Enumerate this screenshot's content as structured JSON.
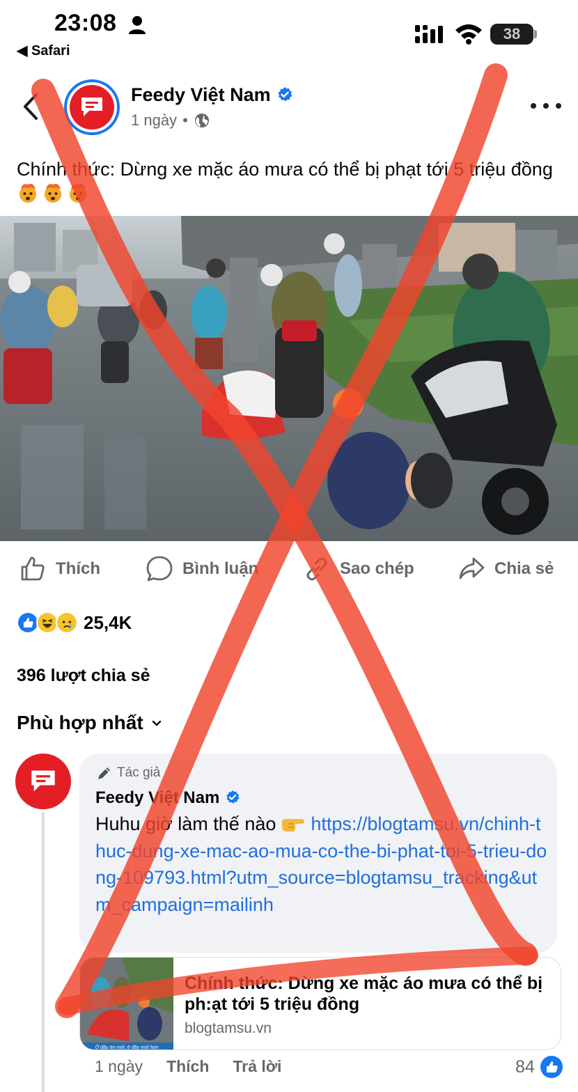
{
  "status_bar": {
    "time": "23:08",
    "back_app": "◀ Safari",
    "battery": "38"
  },
  "post": {
    "page_name": "Feedy Việt Nam",
    "time_ago": "1 ngày",
    "separator": "•",
    "text": "Chính thức: Dừng xe mặc áo mưa có thể bị phạt tới 5 triệu đồng",
    "emojis": [
      "exploding-head-icon",
      "exploding-head-icon",
      "exploding-head-icon"
    ]
  },
  "actions": {
    "like": "Thích",
    "comment": "Bình luận",
    "copy": "Sao chép",
    "share": "Chia sẻ"
  },
  "engagement": {
    "reaction_count": "25,4K",
    "reaction_icons": [
      "like-reaction-icon",
      "haha-reaction-icon",
      "sad-reaction-icon"
    ],
    "shares": "396 lượt chia sẻ",
    "sort": "Phù hợp nhất"
  },
  "comment": {
    "author_tag": "Tác giả",
    "author": "Feedy Việt Nam",
    "text_prefix": "Huhu giờ làm thế nào",
    "link": "https://blogtamsu.vn/chinh-thuc-dung-xe-mac-ao-mua-co-the-bi-phat-toi-5-trieu-dong-109793.html?utm_source=blogtamsu_tracking&utm_campaign=mailinh",
    "preview_title": "Chính thức: Dừng xe mặc áo mưa có thể bị ph:ạt tới 5 triệu đồng",
    "preview_domain": "blogtamsu.vn",
    "thumb_caption": "Ở đâu tin mới, ở đây mới hơn",
    "time": "1 ngày",
    "like": "Thích",
    "reply": "Trả lời",
    "likes": "84"
  },
  "colors": {
    "facebook_blue": "#1877f2",
    "brand_red": "#e41e25",
    "link_blue": "#216fdb",
    "cross_red": "#f0442c"
  }
}
